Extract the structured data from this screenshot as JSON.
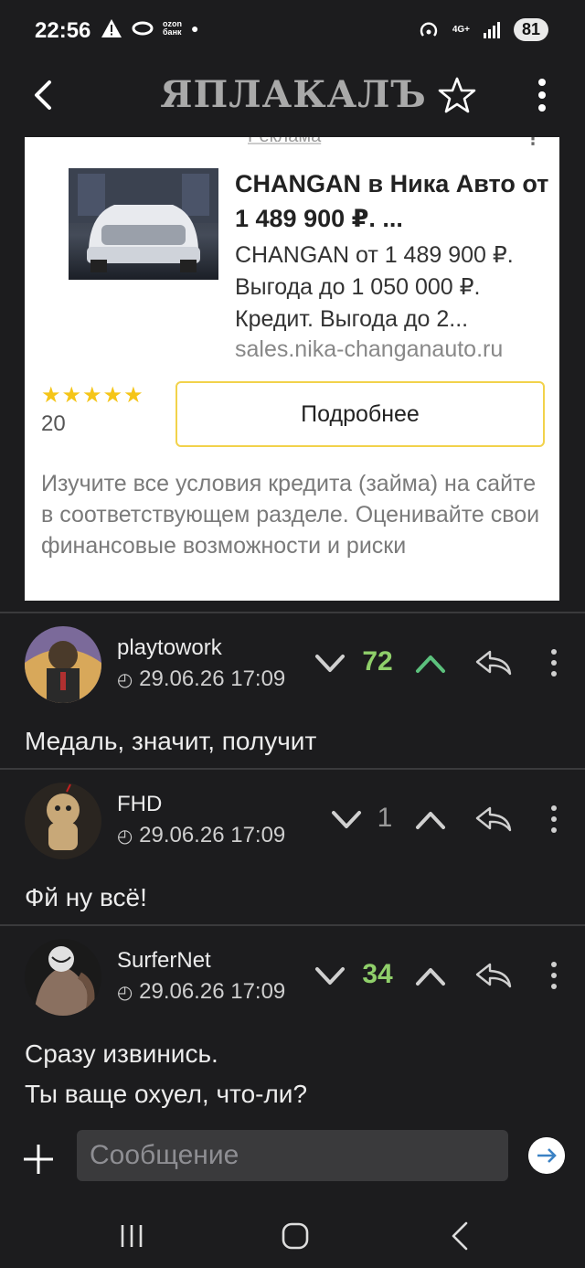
{
  "status_bar": {
    "time": "22:56",
    "ozon_text_1": "ozon",
    "ozon_text_2": "банк",
    "network": "4G+",
    "battery": "81"
  },
  "app_bar": {
    "logo": "ЯПЛАКАЛЪ"
  },
  "ad": {
    "label": "Реклама",
    "title": "CHANGAN в Ника Авто от 1 489 900 ₽. ...",
    "description": "CHANGAN от 1 489 900 ₽. Выгода до 1 050 000 ₽. Кредит. Выгода до 2...",
    "url": "sales.nika-changanauto.ru",
    "rating_stars": "★★★★★",
    "rating_count": "20",
    "button_label": "Подробнее",
    "disclaimer": "Изучите все условия кредита (займа) на сайте в соответствующем разделе. Оценивайте свои финансовые возможности и риски"
  },
  "comments": [
    {
      "user": "playtowork",
      "date": "29.06.26 17:09",
      "votes": "72",
      "vote_color": "#8fcf6a",
      "text": "Медаль, значит, получит"
    },
    {
      "user": "FHD",
      "date": "29.06.26 17:09",
      "votes": "1",
      "vote_color": "#9a9a9a",
      "text": "Фй ну всё!"
    },
    {
      "user": "SurferNet",
      "date": "29.06.26 17:09",
      "votes": "34",
      "vote_color": "#8fcf6a",
      "text": "Сразу извинись.\nТы ваще охуел, что-ли?"
    }
  ],
  "input": {
    "placeholder": "Сообщение"
  },
  "colors": {
    "accent_green": "#8fcf6a",
    "background": "#1c1c1e",
    "ad_button_border": "#f2d24b"
  }
}
